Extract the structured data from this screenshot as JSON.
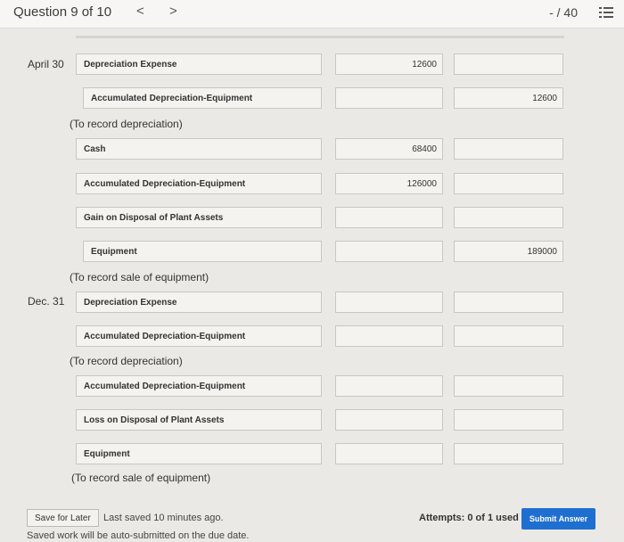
{
  "header": {
    "question_label": "Question 9 of 10",
    "prev_glyph": "<",
    "next_glyph": ">",
    "score": "- / 40"
  },
  "entries": {
    "date1": "April 30",
    "date2": "Dec. 31",
    "rows": [
      {
        "account": "Depreciation Expense",
        "debit": "12600",
        "credit": ""
      },
      {
        "account": "Accumulated Depreciation-Equipment",
        "debit": "",
        "credit": "12600"
      },
      {
        "account": "Cash",
        "debit": "68400",
        "credit": ""
      },
      {
        "account": "Accumulated Depreciation-Equipment",
        "debit": "126000",
        "credit": ""
      },
      {
        "account": "Gain on Disposal of Plant Assets",
        "debit": "",
        "credit": ""
      },
      {
        "account": "Equipment",
        "debit": "",
        "credit": "189000"
      },
      {
        "account": "Depreciation Expense",
        "debit": "",
        "credit": ""
      },
      {
        "account": "Accumulated Depreciation-Equipment",
        "debit": "",
        "credit": ""
      },
      {
        "account": "Accumulated Depreciation-Equipment",
        "debit": "",
        "credit": ""
      },
      {
        "account": "Loss on Disposal of Plant Assets",
        "debit": "",
        "credit": ""
      },
      {
        "account": "Equipment",
        "debit": "",
        "credit": ""
      }
    ],
    "notes": [
      "(To record depreciation)",
      "(To record sale of equipment)",
      "(To record depreciation)",
      "(To record sale of equipment)"
    ]
  },
  "footer": {
    "save_label": "Save for Later",
    "last_saved": "Last saved 10 minutes ago.",
    "auto_submit": "Saved work will be auto-submitted on the due date.",
    "attempts": "Attempts: 0 of 1 used",
    "submit_label": "Submit Answer"
  },
  "colors": {
    "accent": "#1f6fd1",
    "background": "#ebe9e6"
  }
}
